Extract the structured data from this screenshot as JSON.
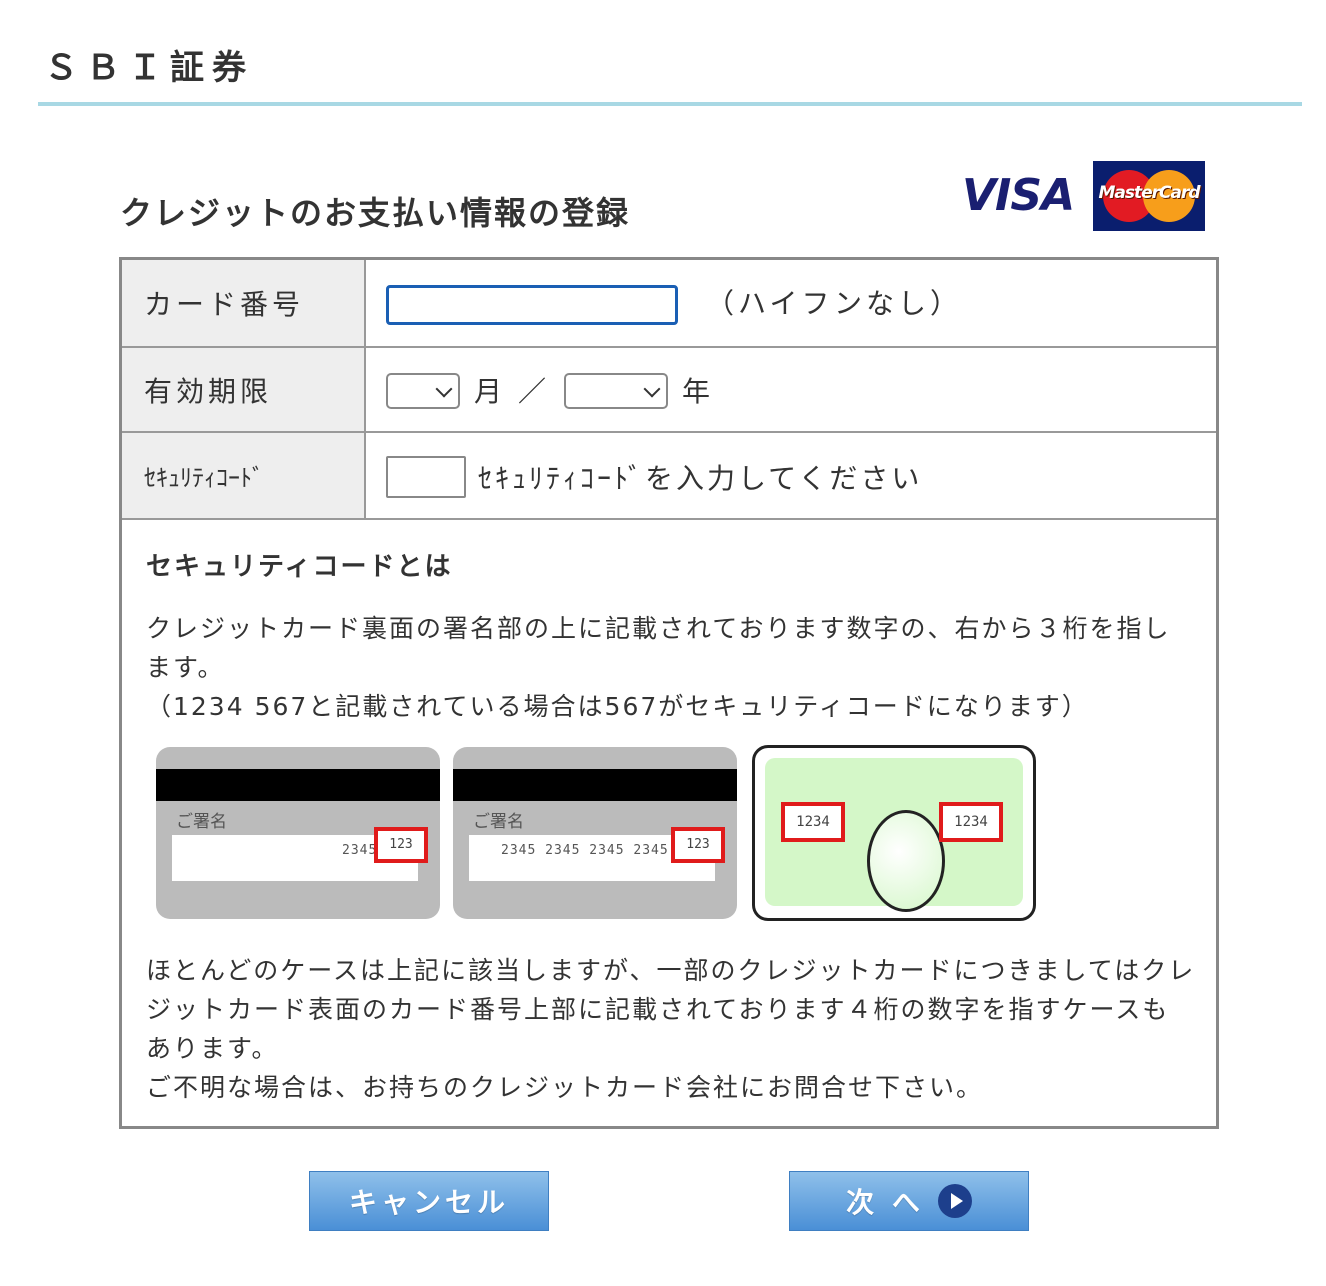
{
  "header": {
    "brand": "ＳＢＩ証券"
  },
  "page": {
    "title": "クレジットのお支払い情報の登録"
  },
  "logos": {
    "visa": "VISA",
    "mastercard": "MasterCard"
  },
  "form": {
    "card_number": {
      "label": "カード番号",
      "value": "",
      "hint": "（ハイフンなし）"
    },
    "expiry": {
      "label": "有効期限",
      "month_value": "",
      "month_label": "月",
      "separator": "／",
      "year_value": "",
      "year_label": "年"
    },
    "security_code": {
      "label": "ｾｷｭﾘﾃｨｺｰﾄﾞ",
      "value": "",
      "hint": "ｾｷｭﾘﾃｨｺｰﾄﾞを入力してください"
    }
  },
  "info": {
    "heading": "セキュリティコードとは",
    "paragraph1": "クレジットカード裏面の署名部の上に記載されております数字の、右から３桁を指します。",
    "paragraph2": "（1234 567と記載されている場合は567がセキュリティコードになります）",
    "card_images": {
      "signature_label": "ご署名",
      "card_a_numbers": "2345",
      "card_b_numbers": "2345 2345 2345 2345",
      "code": "123",
      "front_code": "1234"
    },
    "paragraph3": "ほとんどのケースは上記に該当しますが、一部のクレジットカードにつきましてはクレジットカード表面のカード番号上部に記載されております４桁の数字を指すケースもあります。",
    "paragraph4": "ご不明な場合は、お持ちのクレジットカード会社にお問合せ下さい。"
  },
  "buttons": {
    "cancel": "キャンセル",
    "next": "次 へ"
  },
  "colors": {
    "accent_rule": "#a8d8e4",
    "button_top": "#8fc0ea",
    "button_bottom": "#4a8fd6",
    "highlight_red": "#e01b1b"
  }
}
